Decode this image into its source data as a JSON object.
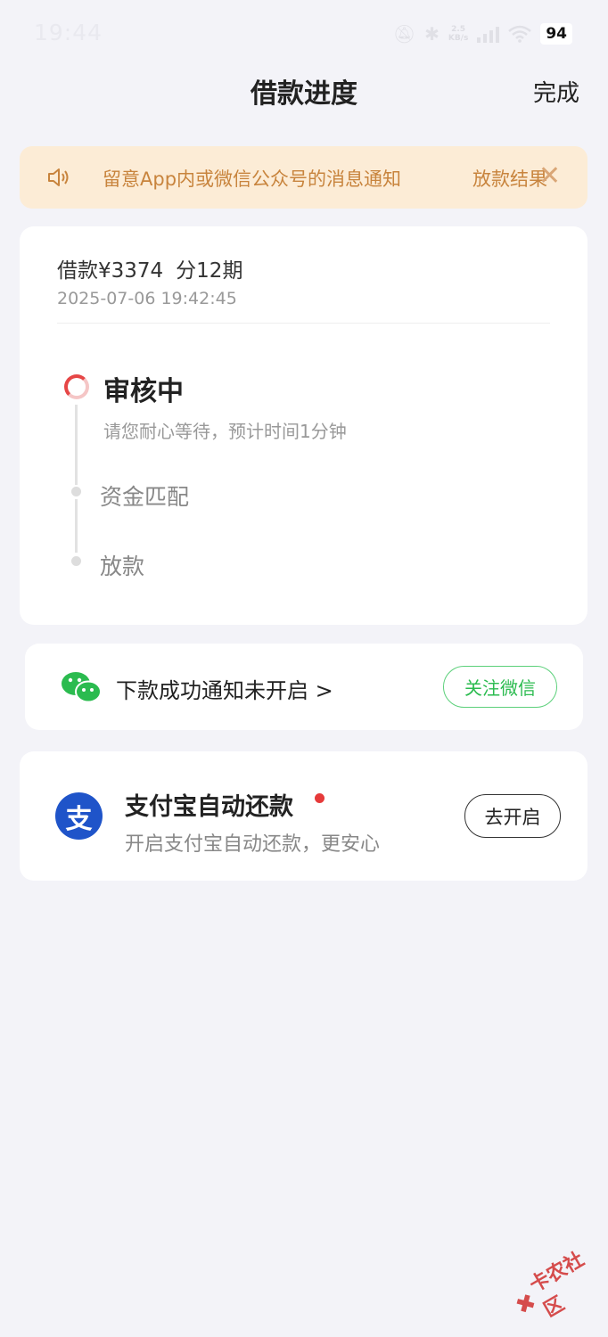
{
  "status_bar": {
    "time": "19:44",
    "network_line1": "2.5",
    "network_line2": "KB/s",
    "battery": "94"
  },
  "nav": {
    "title": "借款进度",
    "done_label": "完成"
  },
  "notice": {
    "message": "留意App内或微信公众号的消息通知",
    "message_tail": "放款结果",
    "close_symbol": "✕",
    "color": "#c8843d"
  },
  "loan": {
    "amount_text": "借款¥3374",
    "installments_text": "分12期",
    "datetime": "2025-07-06 19:42:45"
  },
  "progress": {
    "current_step": {
      "title": "审核中",
      "description": "请您耐心等待，预计时间1分钟",
      "color": "#e64646"
    },
    "pending_steps": [
      {
        "label": "资金匹配"
      },
      {
        "label": "放款"
      }
    ]
  },
  "wechat": {
    "text": "下款成功通知未开启 >",
    "button_label": "关注微信",
    "accent_color": "#2bbb4f"
  },
  "alipay": {
    "logo_char": "支",
    "title": "支付宝自动还款",
    "subtitle": "开启支付宝自动还款，更安心",
    "button_label": "去开启",
    "brand_color": "#1f54c9"
  },
  "watermark": {
    "text": "卡农社区"
  }
}
